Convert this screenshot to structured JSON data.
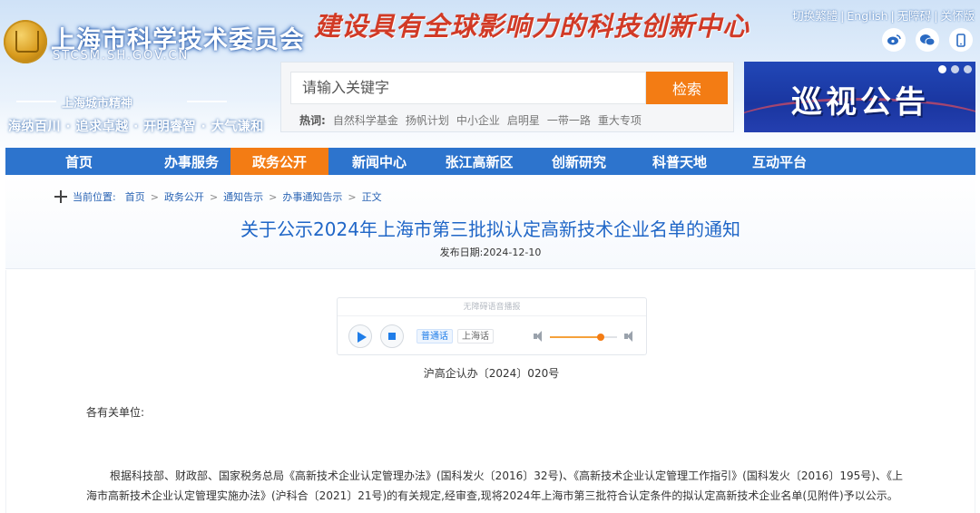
{
  "header": {
    "site_title": "上海市科学技术委员会",
    "site_domain": "STCSM.SH.GOV.CN",
    "slogan": "建设具有全球影响力的科技创新中心",
    "top_links": [
      "切换繁體",
      "English",
      "无障碍",
      "关怀版"
    ],
    "social_icons": [
      "weibo-icon",
      "wechat-icon",
      "mobile-icon"
    ],
    "spirit_label": "上海城市精神",
    "spirit_text": "海纳百川 · 追求卓越 · 开明睿智 · 大气谦和"
  },
  "search": {
    "placeholder": "请输入关键字",
    "button_label": "检索",
    "hot_label": "热词:",
    "hot_keywords": [
      "自然科学基金",
      "扬帆计划",
      "中小企业",
      "启明星",
      "一带一路",
      "重大专项"
    ]
  },
  "banner": {
    "text": "巡视公告"
  },
  "nav": {
    "items": [
      {
        "label": "首页",
        "active": false
      },
      {
        "label": "办事服务",
        "active": false
      },
      {
        "label": "政务公开",
        "active": true
      },
      {
        "label": "新闻中心",
        "active": false
      },
      {
        "label": "张江高新区",
        "active": false
      },
      {
        "label": "创新研究",
        "active": false
      },
      {
        "label": "科普天地",
        "active": false
      },
      {
        "label": "互动平台",
        "active": false
      }
    ]
  },
  "breadcrumb": {
    "label": "当前位置:",
    "items": [
      "首页",
      "政务公开",
      "通知告示",
      "办事通知告示",
      "正文"
    ]
  },
  "article": {
    "title": "关于公示2024年上海市第三批拟认定高新技术企业名单的通知",
    "publish_label": "发布日期:",
    "publish_date": "2024-12-10",
    "doc_number": "沪高企认办〔2024〕020号",
    "greeting": "各有关单位:",
    "body": "根据科技部、财政部、国家税务总局《高新技术企业认定管理办法》(国科发火〔2016〕32号)、《高新技术企业认定管理工作指引》(国科发火〔2016〕195号)、《上海市高新技术企业认定管理实施办法》(沪科合〔2021〕21号)的有关规定,经审查,现将2024年上海市第三批符合认定条件的拟认定高新技术企业名单(见附件)予以公示。"
  },
  "player": {
    "header": "无障碍语音播报",
    "lang_mandarin": "普通话",
    "lang_shanghai": "上海话",
    "volume_level": 0.75
  },
  "colors": {
    "nav_blue": "#2d74cd",
    "accent_orange": "#f37c14",
    "title_blue": "#1f66c7"
  }
}
